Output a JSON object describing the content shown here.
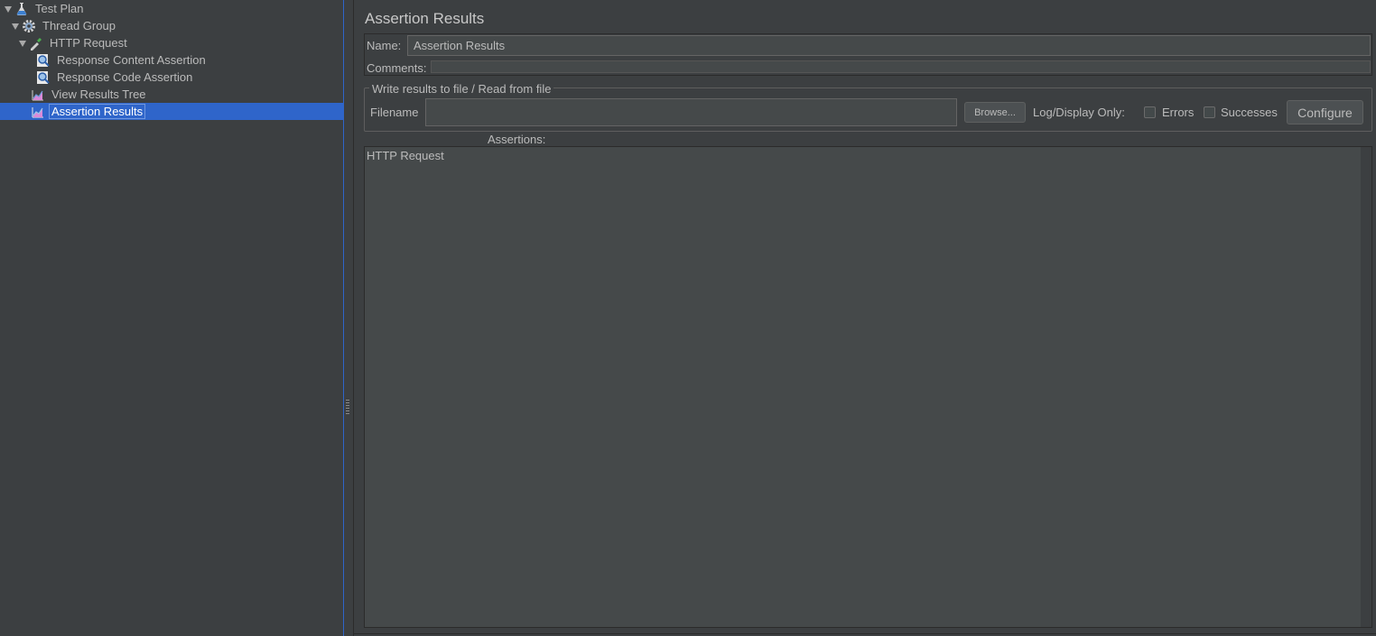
{
  "tree": {
    "items": [
      {
        "label": "Test Plan",
        "icon": "flask-icon",
        "expanded": true
      },
      {
        "label": "Thread Group",
        "icon": "gear-icon",
        "expanded": true
      },
      {
        "label": "HTTP Request",
        "icon": "pipette-icon",
        "expanded": true
      },
      {
        "label": "Response Content Assertion",
        "icon": "magnifier-icon"
      },
      {
        "label": "Response Code Assertion",
        "icon": "magnifier-icon"
      },
      {
        "label": "View Results Tree",
        "icon": "graph-icon"
      },
      {
        "label": "Assertion Results",
        "icon": "graph-icon",
        "selected": true
      }
    ]
  },
  "panel": {
    "title": "Assertion Results",
    "name_label": "Name:",
    "name_value": "Assertion Results",
    "comments_label": "Comments:",
    "file_group_title": "Write results to file / Read from file",
    "filename_label": "Filename",
    "filename_value": "",
    "browse_label": "Browse...",
    "log_display_label": "Log/Display Only:",
    "errors_label": "Errors",
    "successes_label": "Successes",
    "configure_label": "Configure",
    "assertions_label": "Assertions:",
    "assertions_text": "HTTP Request"
  },
  "colors": {
    "background": "#3c3f41",
    "selection": "#2f65ca",
    "text": "#bbbbbb"
  }
}
